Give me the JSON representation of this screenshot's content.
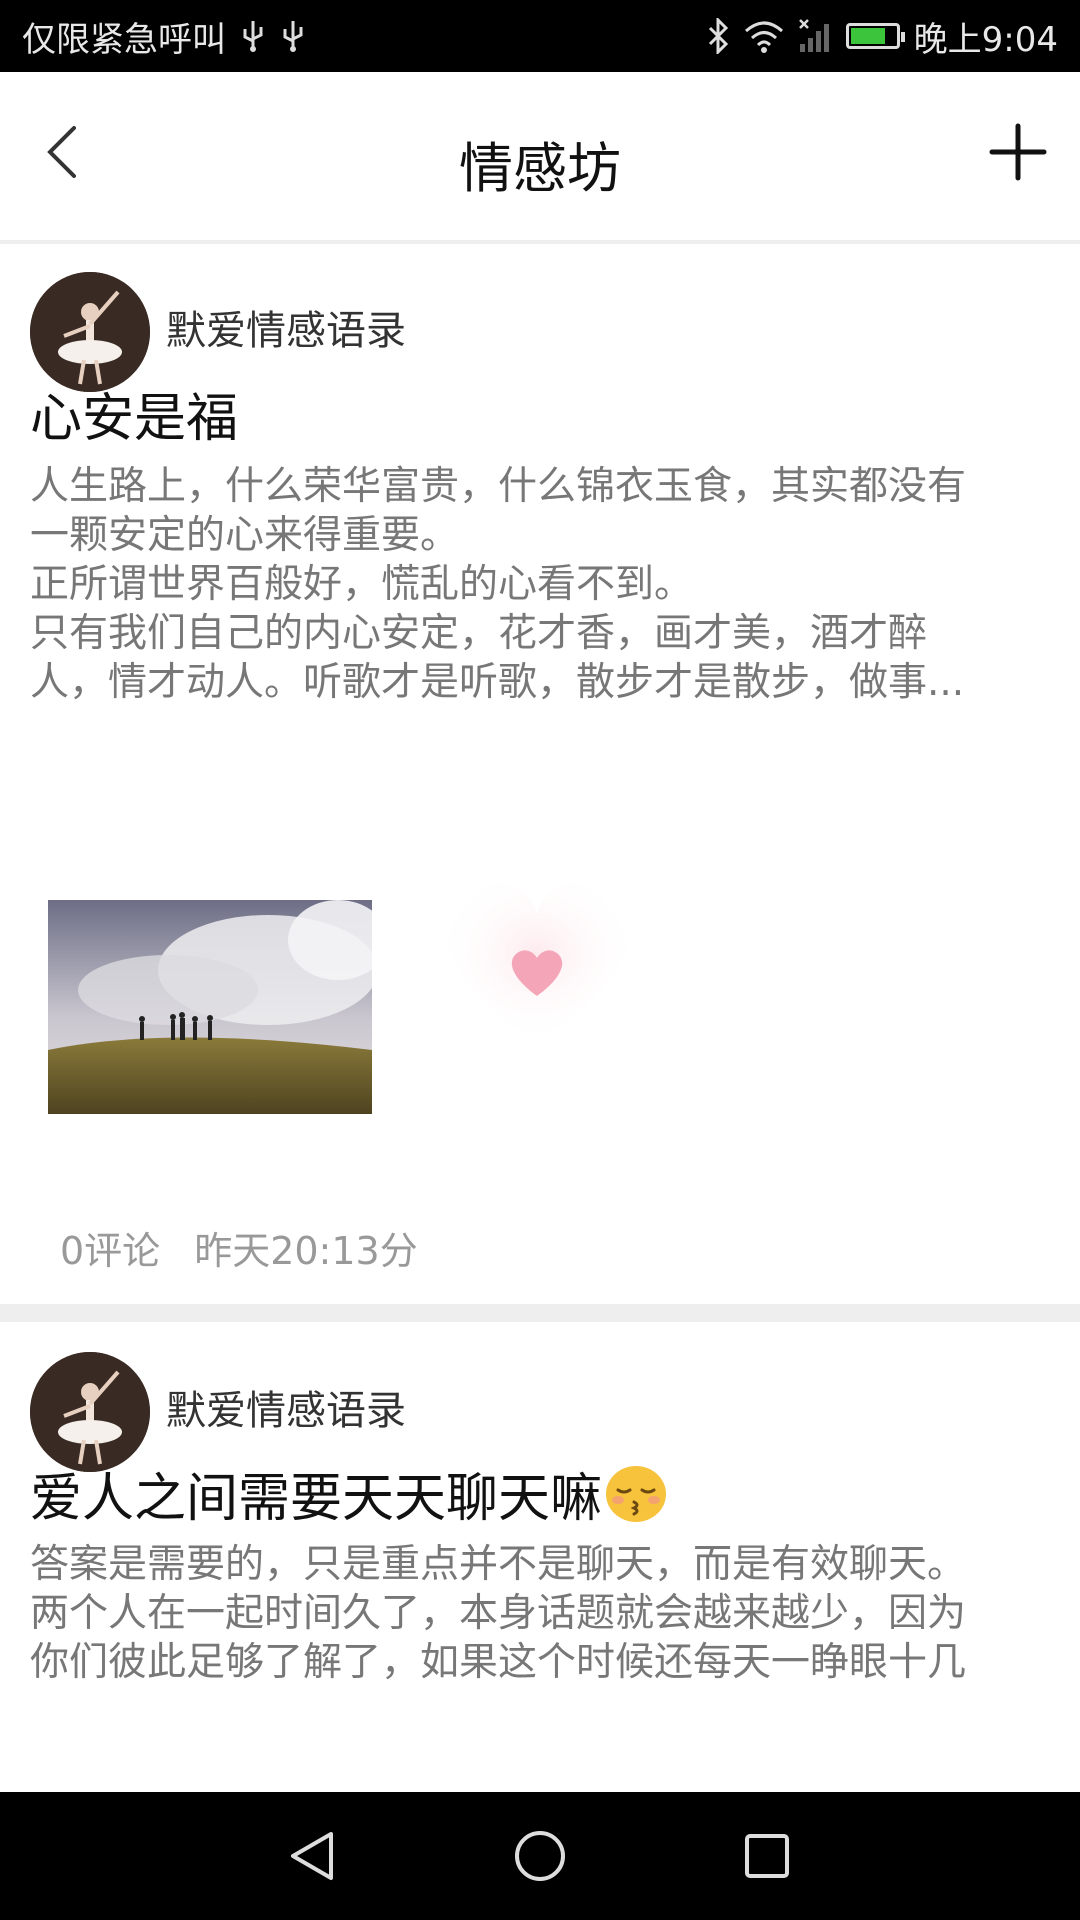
{
  "status_bar": {
    "carrier_text": "仅限紧急呼叫",
    "time": "晚上9:04",
    "icons": [
      "usb-icon",
      "usb-icon",
      "bluetooth-icon",
      "wifi-icon",
      "signal-icon",
      "battery-icon"
    ]
  },
  "header": {
    "title": "情感坊",
    "back_icon": "chevron-left-icon",
    "add_icon": "plus-icon"
  },
  "posts": [
    {
      "author": "默爱情感语录",
      "title": "心安是福",
      "body_lines": [
        "人生路上，什么荣华富贵，什么锦衣玉食，其实都没有",
        "一颗安定的心来得重要。",
        "正所谓世界百般好，慌乱的心看不到。",
        "只有我们自己的内心安定，花才香，画才美，酒才醉",
        "人，情才动人。听歌才是听歌，散步才是散步，做事..."
      ],
      "comments": "0评论",
      "time": "昨天20:13分"
    },
    {
      "author": "默爱情感语录",
      "title": "爱人之间需要天天聊天嘛",
      "title_emoji": "😚",
      "body_lines": [
        "答案是需要的，只是重点并不是聊天，而是有效聊天。",
        "两个人在一起时间久了，本身话题就会越来越少，因为",
        "你们彼此足够了解了，如果这个时候还每天一睁眼十几"
      ]
    }
  ],
  "nav_bar": {
    "icons": [
      "back-triangle-icon",
      "home-circle-icon",
      "recents-square-icon"
    ]
  },
  "colors": {
    "status_bar_bg": "#000000",
    "separator": "#eeeeee",
    "body_text": "#777777",
    "meta_text": "#999999",
    "battery_fill": "#3dc43d",
    "heart": "#f4a6b8"
  },
  "battery_level": 0.8
}
